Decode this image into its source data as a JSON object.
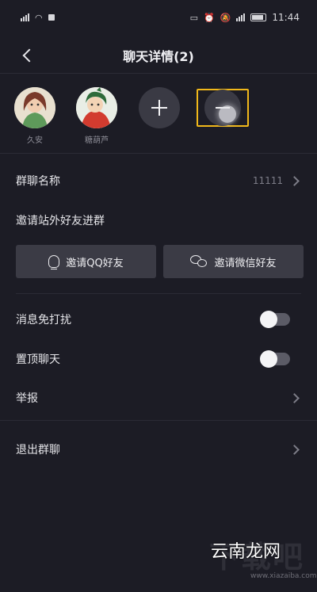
{
  "status_bar": {
    "left_icons": [
      "signal-icon",
      "wifi-icon",
      "notification-icon"
    ],
    "right_icons": [
      "nfc-icon",
      "alarm-icon",
      "mute-icon",
      "signal-icon",
      "battery-icon"
    ],
    "time": "11:44"
  },
  "header": {
    "title": "聊天详情(2)"
  },
  "members": [
    {
      "name": "久安"
    },
    {
      "name": "糖葫芦"
    }
  ],
  "settings": {
    "group_name_label": "群聊名称",
    "group_name_value": "11111",
    "invite_outside_label": "邀请站外好友进群",
    "invite_qq": "邀请QQ好友",
    "invite_wechat": "邀请微信好友",
    "mute_label": "消息免打扰",
    "mute_on": false,
    "pin_label": "置顶聊天",
    "pin_on": false,
    "report_label": "举报",
    "exit_label": "退出群聊"
  },
  "watermark": {
    "big": "下载吧",
    "small": "云南龙网",
    "url": "www.xiazaiba.com"
  },
  "colors": {
    "background": "#1c1c25",
    "highlight": "#f1b81a",
    "button": "#3b3b45"
  }
}
